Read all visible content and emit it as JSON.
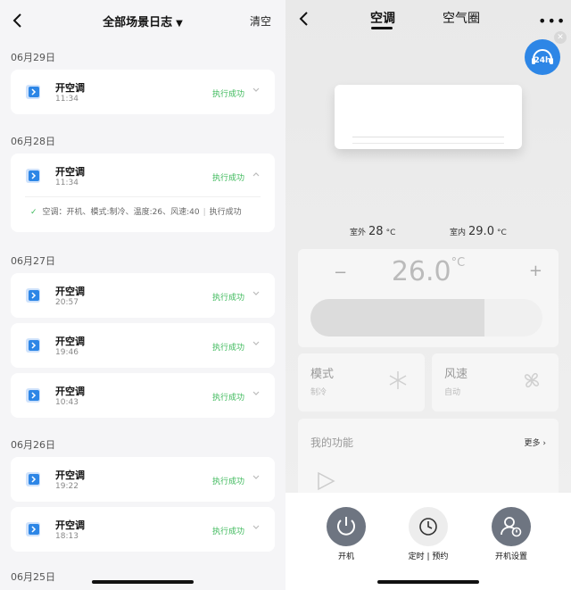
{
  "left": {
    "title": "全部场景日志",
    "clear_label": "清空",
    "groups": [
      {
        "date": "06月29日",
        "entries": [
          {
            "name": "开空调",
            "time": "11:34",
            "status": "执行成功"
          }
        ]
      },
      {
        "date": "06月28日",
        "entries": [
          {
            "name": "开空调",
            "time": "11:34",
            "status": "执行成功",
            "detail": {
              "text": "空调：开机、模式:制冷、温度:26、风速:40",
              "separator": "|",
              "result": "执行成功"
            }
          }
        ]
      },
      {
        "date": "06月27日",
        "entries": [
          {
            "name": "开空调",
            "time": "20:57",
            "status": "执行成功"
          },
          {
            "name": "开空调",
            "time": "19:46",
            "status": "执行成功"
          },
          {
            "name": "开空调",
            "time": "10:43",
            "status": "执行成功"
          }
        ]
      },
      {
        "date": "06月26日",
        "entries": [
          {
            "name": "开空调",
            "time": "19:22",
            "status": "执行成功"
          },
          {
            "name": "开空调",
            "time": "18:13",
            "status": "执行成功"
          }
        ]
      },
      {
        "date": "06月25日",
        "entries": []
      }
    ]
  },
  "right": {
    "tabs": [
      "空调",
      "空气圈"
    ],
    "active_tab": "空调",
    "support_badge": "24h",
    "outdoor": {
      "label": "室外",
      "value": "28",
      "unit": "°C"
    },
    "indoor": {
      "label": "室内",
      "value": "29.0",
      "unit": "°C"
    },
    "temperature": {
      "value": "26.0",
      "unit": "°C",
      "minus": "−",
      "plus": "+",
      "level": 0.75
    },
    "mode": {
      "label": "模式",
      "value": "制冷"
    },
    "fan": {
      "label": "风速",
      "value": "自动"
    },
    "functions": {
      "title": "我的功能",
      "more": "更多"
    },
    "buttons": [
      {
        "label": "开机"
      },
      {
        "label": "定时 | 预约"
      },
      {
        "label": "开机设置"
      }
    ]
  },
  "colors": {
    "success": "#3cb95a",
    "accent_blue": "#2d86e6",
    "button_dark": "#6e7581"
  }
}
